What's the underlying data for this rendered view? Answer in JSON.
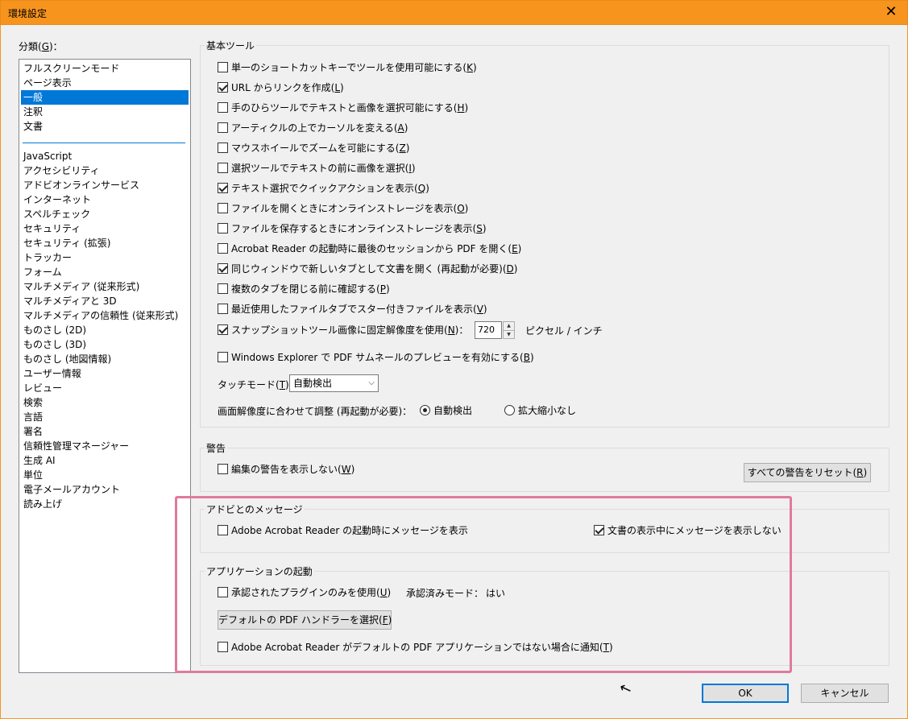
{
  "window": {
    "title": "環境設定",
    "close_glyph": "✕"
  },
  "categories": {
    "label": "分類(",
    "label_key": "G",
    "label_end": ")：",
    "top_items": [
      "フルスクリーンモード",
      "ページ表示",
      "一般",
      "注釈",
      "文書"
    ],
    "selected": "一般",
    "bottom_items": [
      "JavaScript",
      "アクセシビリティ",
      "アドビオンラインサービス",
      "インターネット",
      "スペルチェック",
      "セキュリティ",
      "セキュリティ (拡張)",
      "トラッカー",
      "フォーム",
      "マルチメディア (従来形式)",
      "マルチメディアと 3D",
      "マルチメディアの信頼性 (従来形式)",
      "ものさし (2D)",
      "ものさし (3D)",
      "ものさし (地図情報)",
      "ユーザー情報",
      "レビュー",
      "検索",
      "言語",
      "署名",
      "信頼性管理マネージャー",
      "生成 AI",
      "単位",
      "電子メールアカウント",
      "読み上げ"
    ]
  },
  "basic_tools": {
    "title": "基本ツール",
    "options": [
      {
        "text": "単一のショートカットキーでツールを使用可能にする(",
        "key": "K",
        "end": ")",
        "checked": false
      },
      {
        "text": "URL からリンクを作成(",
        "key": "L",
        "end": ")",
        "checked": true
      },
      {
        "text": "手のひらツールでテキストと画像を選択可能にする(",
        "key": "H",
        "end": ")",
        "checked": false
      },
      {
        "text": "アーティクルの上でカーソルを変える(",
        "key": "A",
        "end": ")",
        "checked": false
      },
      {
        "text": "マウスホイールでズームを可能にする(",
        "key": "Z",
        "end": ")",
        "checked": false
      },
      {
        "text": "選択ツールでテキストの前に画像を選択(",
        "key": "I",
        "end": ")",
        "checked": false
      },
      {
        "text": "テキスト選択でクイックアクションを表示(",
        "key": "Q",
        "end": ")",
        "checked": true
      },
      {
        "text": "ファイルを開くときにオンラインストレージを表示(",
        "key": "O",
        "end": ")",
        "checked": false
      },
      {
        "text": "ファイルを保存するときにオンラインストレージを表示(",
        "key": "S",
        "end": ")",
        "checked": false
      },
      {
        "text": "Acrobat Reader の起動時に最後のセッションから PDF を開く(",
        "key": "E",
        "end": ")",
        "checked": false
      },
      {
        "text": "同じウィンドウで新しいタブとして文書を開く (再起動が必要)(",
        "key": "D",
        "end": ")",
        "checked": true
      },
      {
        "text": "複数のタブを閉じる前に確認する(",
        "key": "P",
        "end": ")",
        "checked": false
      },
      {
        "text": "最近使用したファイルタブでスター付きファイルを表示(",
        "key": "V",
        "end": ")",
        "checked": false
      }
    ],
    "snapshot": {
      "text": "スナップショットツール画像に固定解像度を使用(",
      "key": "N",
      "end": ")：",
      "checked": true,
      "value": "720",
      "unit": "ピクセル / インチ",
      "up": "▲",
      "down": "▼"
    },
    "explorer": {
      "text": "Windows Explorer で PDF サムネールのプレビューを有効にする(",
      "key": "B",
      "end": ")",
      "checked": false
    },
    "touch_mode": {
      "label": "タッチモード(",
      "key": "T",
      "end": ")：",
      "value": "自動検出",
      "arrow": "⌵"
    },
    "resolution": {
      "label": "画面解像度に合わせて調整 (再起動が必要)：",
      "option_auto": "自動検出",
      "option_none": "拡大縮小なし",
      "selected": "自動検出"
    }
  },
  "warnings": {
    "title": "警告",
    "option": {
      "text": "編集の警告を表示しない(",
      "key": "W",
      "end": ")",
      "checked": false
    },
    "reset_button": {
      "text": "すべての警告をリセット(",
      "key": "R",
      "end": ")"
    }
  },
  "messages": {
    "title": "アドビとのメッセージ",
    "startup": {
      "text": "Adobe Acrobat Reader の起動時にメッセージを表示",
      "checked": false
    },
    "viewing": {
      "text": "文書の表示中にメッセージを表示しない",
      "checked": true
    }
  },
  "app_startup": {
    "title": "アプリケーションの起動",
    "certified": {
      "text": "承認されたプラグインのみを使用(",
      "key": "U",
      "end": ")",
      "checked": false
    },
    "certified_mode_label": "承認済みモード：",
    "certified_mode_value": "はい",
    "default_handler_button": {
      "text": "デフォルトの PDF ハンドラーを選択(",
      "key": "F",
      "end": ")"
    },
    "notify": {
      "text": "Adobe Acrobat Reader がデフォルトの PDF アプリケーションではない場合に通知(",
      "key": "T",
      "end": ")",
      "checked": false
    }
  },
  "footer": {
    "ok": "OK",
    "cancel": "キャンセル"
  },
  "colors": {
    "title_bar": "#f7941d",
    "selection": "#0078d7",
    "highlight": "#e07a9c"
  }
}
